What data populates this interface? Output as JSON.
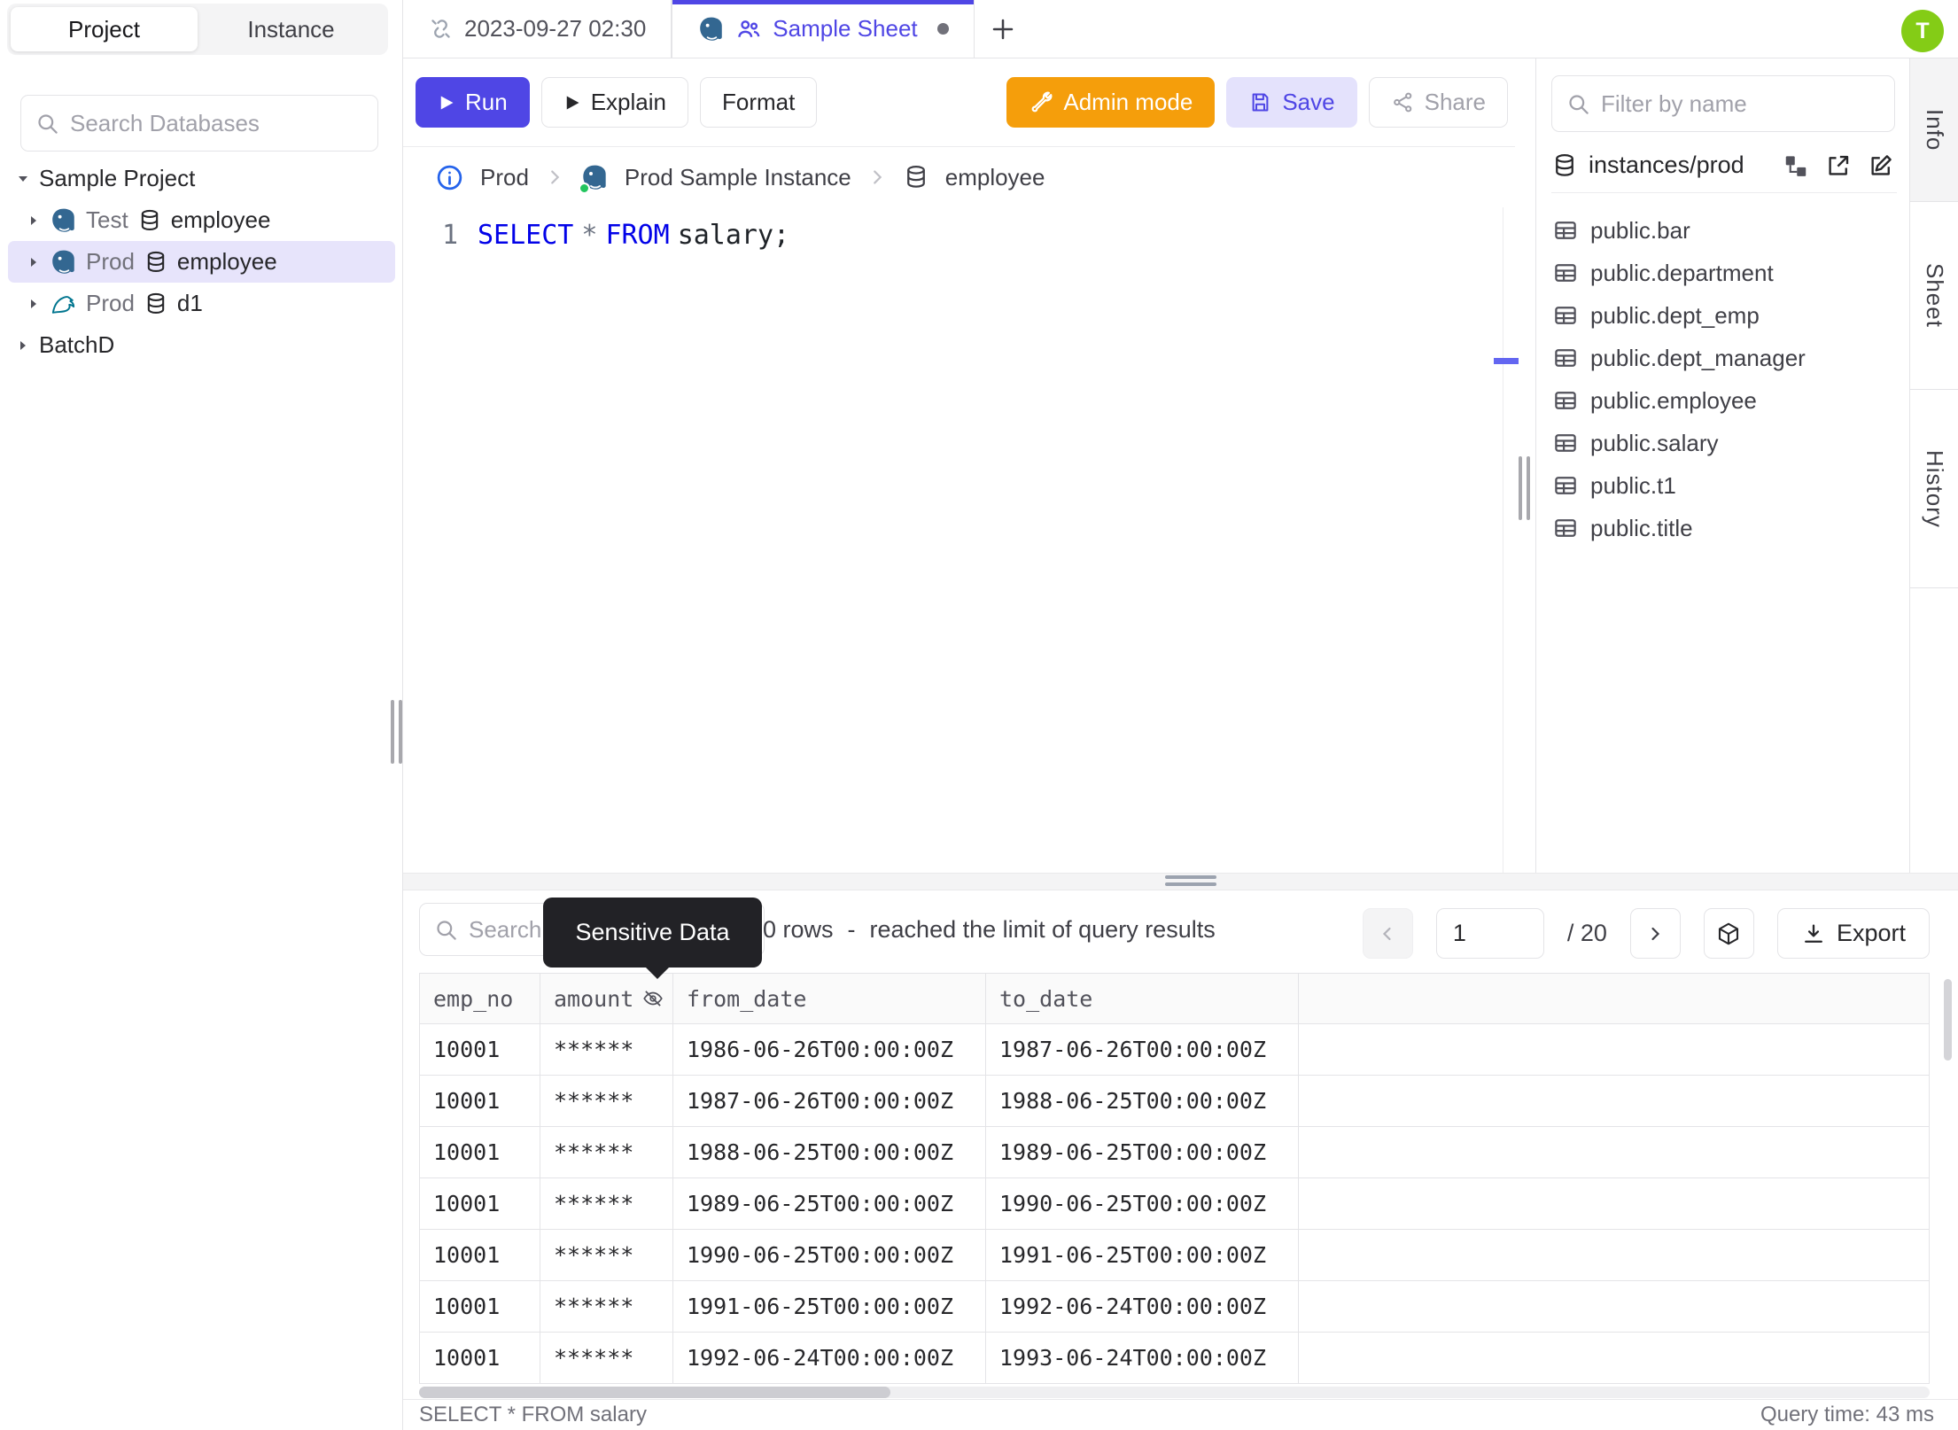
{
  "app": {
    "avatar_initial": "T"
  },
  "sidebar": {
    "tabs": {
      "project": "Project",
      "instance": "Instance"
    },
    "search_placeholder": "Search Databases",
    "tree": [
      {
        "label": "Sample Project"
      },
      {
        "env": "Test",
        "db": "employee"
      },
      {
        "env": "Prod",
        "db": "employee"
      },
      {
        "env": "Prod",
        "db": "d1"
      },
      {
        "label": "BatchD"
      }
    ]
  },
  "tabbar": {
    "tab1": "2023-09-27 02:30",
    "tab2": "Sample Sheet",
    "add": "+"
  },
  "toolbar": {
    "run": "Run",
    "explain": "Explain",
    "format": "Format",
    "admin": "Admin mode",
    "save": "Save",
    "share": "Share"
  },
  "breadcrumb": {
    "env": "Prod",
    "instance": "Prod Sample Instance",
    "database": "employee"
  },
  "editor": {
    "line_number": "1",
    "kw_select": "SELECT",
    "star": "*",
    "kw_from": "FROM",
    "tail": "salary;"
  },
  "right_panel": {
    "filter_placeholder": "Filter by name",
    "scope": "instances/prod",
    "tables": [
      "public.bar",
      "public.department",
      "public.dept_emp",
      "public.dept_manager",
      "public.employee",
      "public.salary",
      "public.t1",
      "public.title"
    ]
  },
  "side_tabs": {
    "info": "Info",
    "sheet": "Sheet",
    "history": "History"
  },
  "results": {
    "search_placeholder": "Search",
    "tooltip": "Sensitive Data",
    "row_count": "0 rows",
    "separator": "-",
    "limit_note": "reached the limit of query results",
    "page_value": "1",
    "page_total": "/ 20",
    "export_label": "Export",
    "columns": [
      "emp_no",
      "amount",
      "from_date",
      "to_date"
    ],
    "rows": [
      [
        "10001",
        "******",
        "1986-06-26T00:00:00Z",
        "1987-06-26T00:00:00Z"
      ],
      [
        "10001",
        "******",
        "1987-06-26T00:00:00Z",
        "1988-06-25T00:00:00Z"
      ],
      [
        "10001",
        "******",
        "1988-06-25T00:00:00Z",
        "1989-06-25T00:00:00Z"
      ],
      [
        "10001",
        "******",
        "1989-06-25T00:00:00Z",
        "1990-06-25T00:00:00Z"
      ],
      [
        "10001",
        "******",
        "1990-06-25T00:00:00Z",
        "1991-06-25T00:00:00Z"
      ],
      [
        "10001",
        "******",
        "1991-06-25T00:00:00Z",
        "1992-06-24T00:00:00Z"
      ],
      [
        "10001",
        "******",
        "1992-06-24T00:00:00Z",
        "1993-06-24T00:00:00Z"
      ]
    ],
    "status_left": "SELECT * FROM salary",
    "status_right": "Query time: 43 ms"
  },
  "colors": {
    "accent": "#4f46e5",
    "admin_orange": "#f59e0b",
    "avatar_green": "#84cc16",
    "selected_tree_row": "#e7e4fb",
    "keyword_blue": "#0202e8",
    "tooltip_bg": "#222226",
    "status_green": "#22c55e"
  }
}
